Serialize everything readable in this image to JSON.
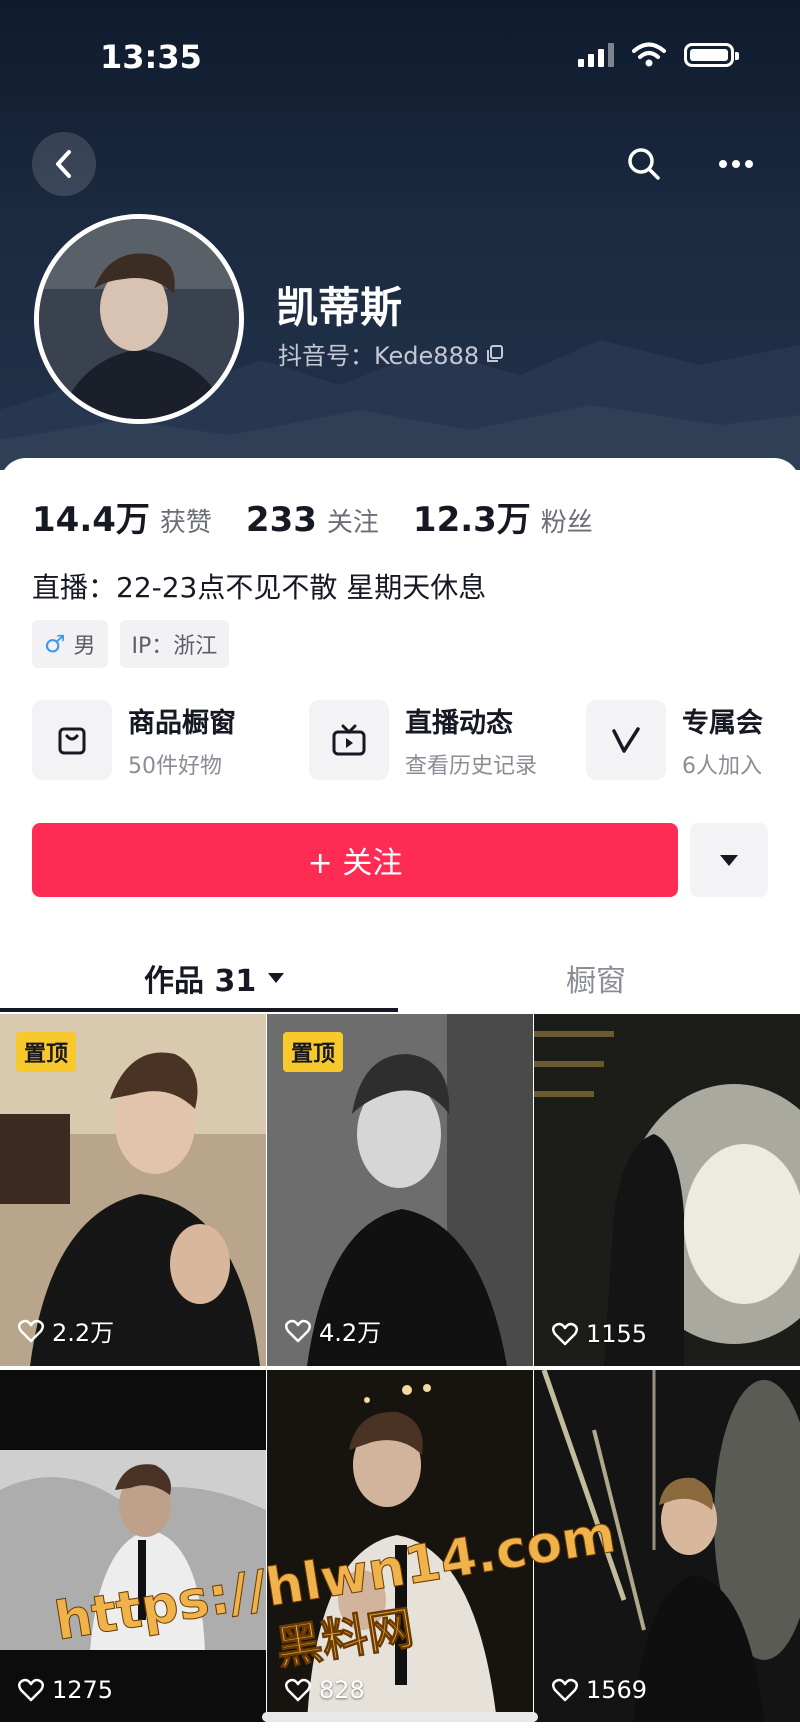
{
  "status_bar": {
    "time": "13:35"
  },
  "header": {
    "nickname": "凯蒂斯",
    "douyin_id": "抖音号：Kede888"
  },
  "stats": [
    {
      "value": "14.4万",
      "label": "获赞"
    },
    {
      "value": "233",
      "label": "关注"
    },
    {
      "value": "12.3万",
      "label": "粉丝"
    }
  ],
  "bio": "直播：22-23点不见不散 星期天休息",
  "tags": {
    "gender_symbol": "♂",
    "gender": "男",
    "ip": "IP：浙江"
  },
  "features": [
    {
      "title": "商品橱窗",
      "sub": "50件好物",
      "icon": "bag-icon"
    },
    {
      "title": "直播动态",
      "sub": "查看历史记录",
      "icon": "tv-icon"
    },
    {
      "title": "专属会",
      "sub": "6人加入",
      "icon": "v-icon"
    }
  ],
  "follow_button": "+ 关注",
  "tabs": {
    "works": "作品 31",
    "shop": "橱窗"
  },
  "videos": [
    {
      "pinned": "置顶",
      "likes": "2.2万"
    },
    {
      "pinned": "置顶",
      "likes": "4.2万"
    },
    {
      "pinned": "",
      "likes": "1155"
    },
    {
      "pinned": "",
      "likes": "1275"
    },
    {
      "pinned": "",
      "likes": "828"
    },
    {
      "pinned": "",
      "likes": "1569"
    }
  ],
  "watermark": {
    "line1": "https://hlwn14.com",
    "line2": "黑料网"
  },
  "colors": {
    "accent": "#fe2c55",
    "pin_badge": "#f7c92d",
    "header_bg": "#1b2a40"
  }
}
